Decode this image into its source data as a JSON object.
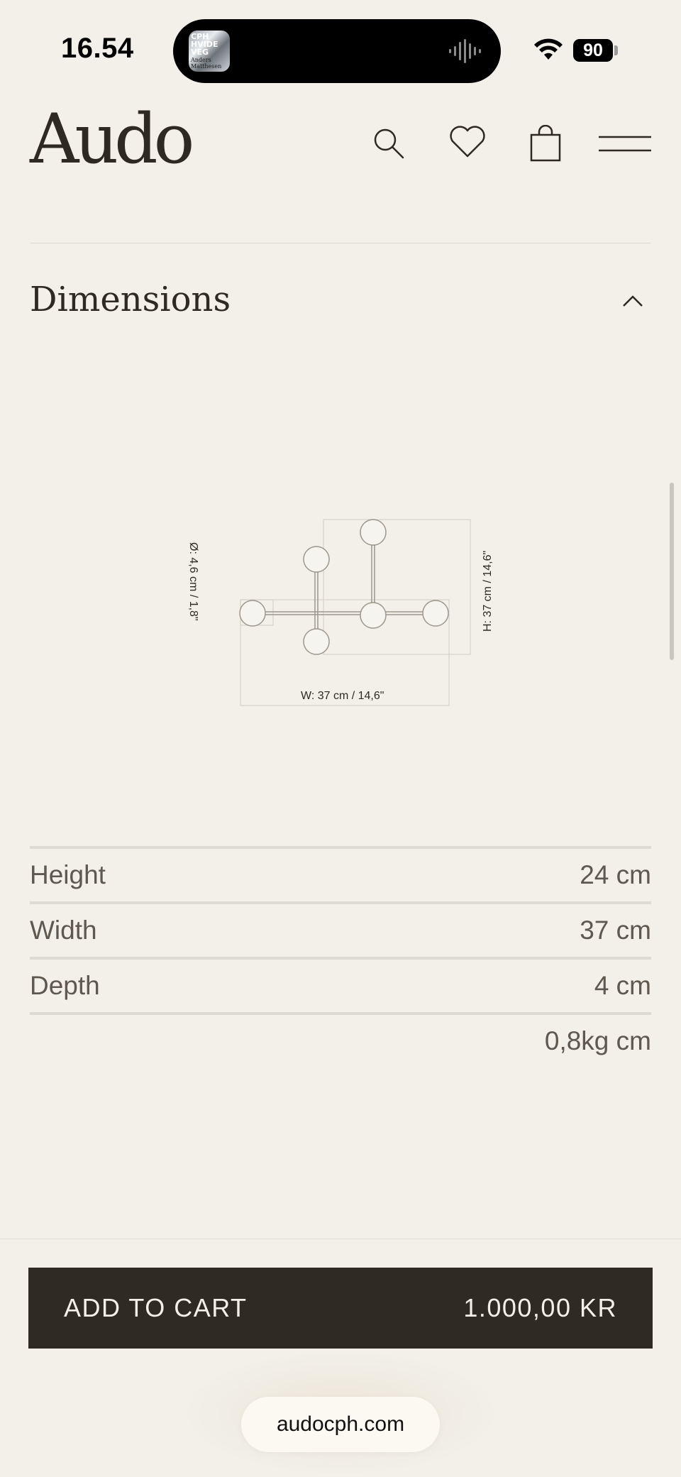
{
  "status_bar": {
    "time": "16.54",
    "battery": "90",
    "now_playing_art": [
      "CPH",
      "HVIDE",
      "VEG"
    ],
    "now_playing_artist": [
      "Anders",
      "Matthesen"
    ]
  },
  "header": {
    "logo": "Audo",
    "icons": [
      "search-icon",
      "heart-icon",
      "bag-icon",
      "menu-icon"
    ]
  },
  "section": {
    "title": "Dimensions",
    "expanded": true
  },
  "drawing": {
    "diameter_label": "Ø: 4,6 cm / 1,8\"",
    "height_label": "H: 37 cm / 14,6\"",
    "width_label": "W: 37 cm / 14,6\""
  },
  "specs": [
    {
      "label": "Height",
      "value": "24 cm"
    },
    {
      "label": "Width",
      "value": "37 cm"
    },
    {
      "label": "Depth",
      "value": "4 cm"
    },
    {
      "label": "",
      "value": "0,8kg cm"
    }
  ],
  "cart": {
    "label": "ADD TO CART",
    "price": "1.000,00 KR"
  },
  "browser": {
    "url": "audocph.com"
  },
  "colors": {
    "background": "#f2f0e9",
    "button": "#2f2a23",
    "text": "#2e2a23"
  }
}
